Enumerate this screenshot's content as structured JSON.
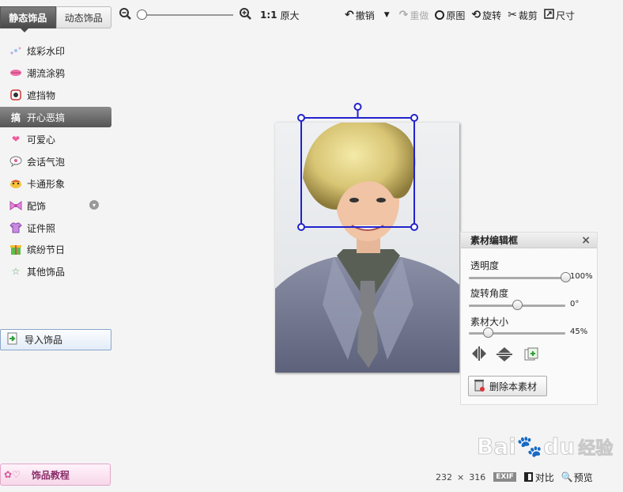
{
  "sidebar": {
    "tabs": [
      {
        "label": "静态饰品"
      },
      {
        "label": "动态饰品"
      }
    ],
    "categories": [
      {
        "label": "炫彩水印",
        "icon": "sparkle-icon"
      },
      {
        "label": "潮流涂鸦",
        "icon": "lips-icon"
      },
      {
        "label": "遮挡物",
        "icon": "mask-icon"
      },
      {
        "label": "开心恶搞",
        "icon": "gao-icon",
        "icon_text": "搞"
      },
      {
        "label": "可爱心",
        "icon": "heart-icon"
      },
      {
        "label": "会话气泡",
        "icon": "speech-bubble-icon"
      },
      {
        "label": "卡通形象",
        "icon": "cartoon-face-icon"
      },
      {
        "label": "配饰",
        "icon": "bow-icon"
      },
      {
        "label": "证件照",
        "icon": "shirt-icon"
      },
      {
        "label": "缤纷节日",
        "icon": "gift-icon"
      },
      {
        "label": "其他饰品",
        "icon": "star-icon"
      }
    ],
    "import_label": "导入饰品",
    "tutorial_label": "饰品教程"
  },
  "toolbar": {
    "zoom_ratio": "1:1",
    "original_size": "原大",
    "undo": "撤销",
    "redo": "重做",
    "original": "原图",
    "rotate": "旋转",
    "crop": "裁剪",
    "size": "尺寸"
  },
  "panel": {
    "title": "素材编辑框",
    "close": "×",
    "opacity_label": "透明度",
    "opacity_value": "100%",
    "opacity": 1.0,
    "angle_label": "旋转角度",
    "angle_value": "0°",
    "angle": 0.5,
    "size_label": "素材大小",
    "size_value": "45%",
    "size": 0.2,
    "delete_label": "删除本素材"
  },
  "status": {
    "width": "232",
    "times": "×",
    "height": "316",
    "exif": "EXIF",
    "compare": "对比",
    "preview": "预览"
  },
  "watermark": {
    "text": "Bai",
    "text2": "du",
    "text3": "经验"
  },
  "colors": {
    "accent": "#2222cc",
    "tab_active": "#4a4a4a"
  }
}
